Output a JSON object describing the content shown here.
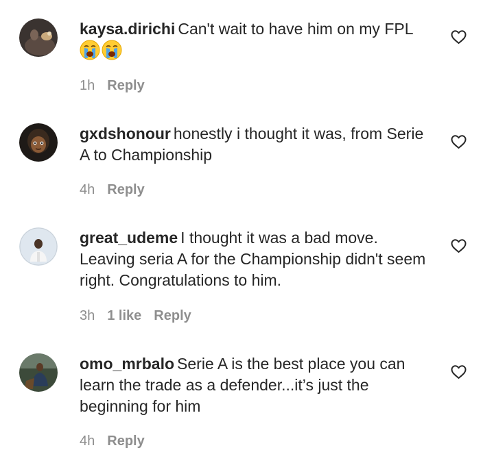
{
  "comments": [
    {
      "username": "kaysa.dirichi",
      "text": "Can't wait to have him on my FPL",
      "emojis": [
        "crying-face",
        "crying-face"
      ],
      "time": "1h",
      "likes": "",
      "reply_label": "Reply"
    },
    {
      "username": "gxdshonour",
      "text": "honestly i thought it was, from Serie A to Championship",
      "time": "4h",
      "likes": "",
      "reply_label": "Reply"
    },
    {
      "username": "great_udeme",
      "text": "I thought it was a bad move. Leaving seria A for the Championship didn't seem right. Congratulations to him.",
      "time": "3h",
      "likes": "1 like",
      "reply_label": "Reply"
    },
    {
      "username": "omo_mrbalo",
      "text": "Serie A is the best place you can learn the trade as a defender...it’s just the beginning for him",
      "time": "4h",
      "likes": "",
      "reply_label": "Reply"
    }
  ],
  "colors": {
    "text": "#262626",
    "secondary": "#8e8e8e",
    "background": "#ffffff"
  },
  "icons": {
    "like": "heart-outline-icon"
  }
}
